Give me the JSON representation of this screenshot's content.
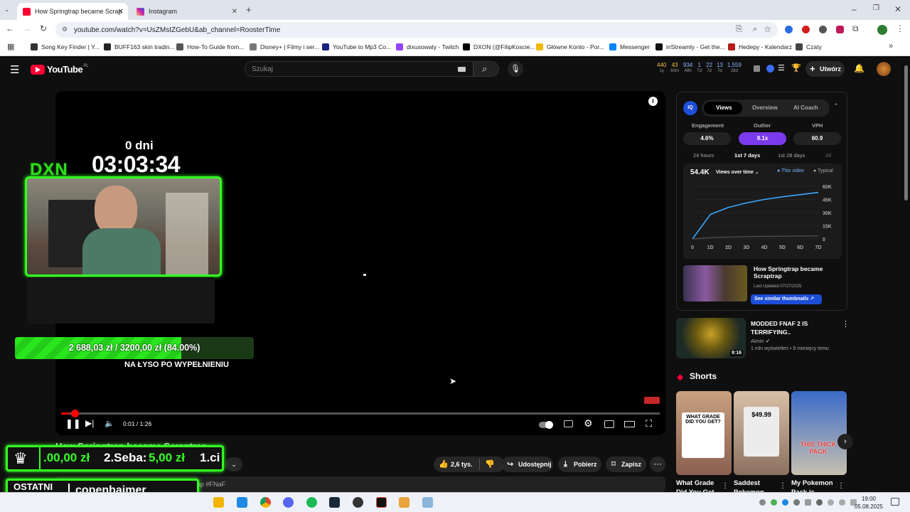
{
  "tabs": [
    {
      "title": "How Springtrap became Scrap",
      "active": true,
      "color": "#ff0033"
    },
    {
      "title": "Instagram",
      "active": false,
      "color": "#d6249f"
    }
  ],
  "address": {
    "url": "youtube.com/watch?v=UsZMsIZGebU&ab_channel=RoosterTime"
  },
  "bookmarks": [
    {
      "label": "Song Key Finder | Y...",
      "color": "#333"
    },
    {
      "label": "BUFF163 skin tradin...",
      "color": "#222"
    },
    {
      "label": "How-To Guide from...",
      "color": "#555"
    },
    {
      "label": "Disney+ | Filmy i ser...",
      "color": "#777"
    },
    {
      "label": "YouTube to Mp3 Co...",
      "color": "#1a237e"
    },
    {
      "label": "dixusowaty - Twitch",
      "color": "#9146ff"
    },
    {
      "label": "DXON (@FilipKoscie...",
      "color": "#000"
    },
    {
      "label": "Główne Konto - Por...",
      "color": "#f0b90b"
    },
    {
      "label": "Messenger",
      "color": "#0084ff"
    },
    {
      "label": "inStreamly - Get the...",
      "color": "#111"
    },
    {
      "label": "Hedepy - Kalendarz",
      "color": "#b71c1c"
    },
    {
      "label": "Czaty",
      "color": "#444"
    }
  ],
  "youtube": {
    "logo": "YouTube",
    "region": "PL",
    "search_placeholder": "Szukaj",
    "create_label": "Utwórz",
    "stats": [
      {
        "value": "440",
        "sub": "1y"
      },
      {
        "value": "43",
        "sub": "60m"
      },
      {
        "value": "934",
        "sub": "48h"
      },
      {
        "value": "1",
        "sub": "7d"
      },
      {
        "value": "22",
        "sub": "7d"
      },
      {
        "value": "13",
        "sub": "7d"
      },
      {
        "value": "1,559",
        "sub": "28d"
      }
    ]
  },
  "player": {
    "timer_label": "0 dni",
    "timer": "03:03:34",
    "brand": "DXN",
    "goal": "2 688,03 zł  /  3200,00 zł (84.00%)",
    "goal_progress": 0.84,
    "goal_caption": "NA ŁYSO PO WYPEŁNIENIU",
    "time": "0:01 / 1:26",
    "progress": 0.013
  },
  "video": {
    "title_partial": "How Springtrap became Scraptrap",
    "likes": "2,6 tys.",
    "share": "Udostępnij",
    "download": "Pobierz",
    "save": "Zapisz",
    "hashtag_partial": "rap #FNaF"
  },
  "stream_overlay": {
    "ticker": ".00,00 zł   2.Seba: 5,00 zł   1.ci",
    "ticker_seba": "2.Seba:",
    "ticker_amount": "5,00 zł",
    "ticker_first": ".00,00 zł",
    "ticker_last": "1.ci",
    "last_sub_label": "OSTATNI SUB",
    "last_sub_name": "copenhaimer"
  },
  "vidiq": {
    "tabs": [
      "Views",
      "Overview",
      "AI Coach"
    ],
    "metrics": [
      {
        "label": "Engagement",
        "value": "4.6%"
      },
      {
        "label": "Outlier",
        "value": "9.1x"
      },
      {
        "label": "VPH",
        "value": "60.9"
      }
    ],
    "ranges": [
      "24 hours",
      "1st 7 days",
      "1st 28 days",
      "All"
    ],
    "views_total": "54.4K",
    "views_dropdown": "Views over time",
    "legend_this": "This video",
    "legend_typical": "Typical",
    "thumb_title": "How Springtrap became Scraptrap",
    "thumb_updated": "Last Updated 07/27/2025",
    "thumb_button": "See similar thumbnails"
  },
  "chart_data": {
    "type": "line",
    "x": [
      "0",
      "1D",
      "2D",
      "3D",
      "4D",
      "5D",
      "6D",
      "7D"
    ],
    "yticks": [
      "0",
      "15K",
      "30K",
      "45K",
      "60K"
    ],
    "ylim": [
      0,
      60000
    ],
    "series": [
      {
        "name": "This video",
        "values": [
          0,
          28000,
          36000,
          41000,
          45000,
          48000,
          50500,
          53000
        ]
      },
      {
        "name": "Typical",
        "values": [
          0,
          1500,
          2200,
          2600,
          2900,
          3100,
          3300,
          3400
        ]
      }
    ]
  },
  "recommended": {
    "title": "MODDED FNAF 2 IS TERRIFYING..",
    "channel": "Aimin",
    "meta": "1 mln wyświetleń • 9 miesięcy temu",
    "duration": "9:16"
  },
  "shorts": {
    "heading": "Shorts",
    "items": [
      {
        "title": "What Grade Did You Get",
        "badge": "WHAT GRADE DID YOU GET?"
      },
      {
        "title": "Saddest Pokemon",
        "badge": "$49.99"
      },
      {
        "title": "My Pokemon Pack is",
        "badge": "THIS THICK PACK"
      }
    ]
  },
  "taskbar": {
    "time": "19:00",
    "date": "05.08.2025"
  }
}
